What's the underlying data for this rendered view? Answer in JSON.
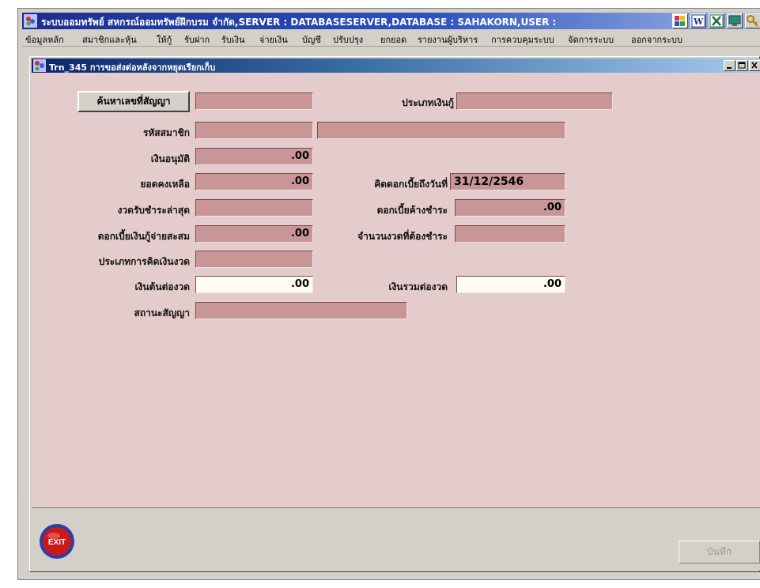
{
  "app": {
    "title": "ระบบออมทรัพย์ สหกรณ์ออมทรัพย์ฝึกบรม จำกัด,SERVER : DATABASESERVER,DATABASE : SAHAKORN,USER :"
  },
  "menu": [
    "ข้อมูลหลัก",
    "สมาชิกและหุ้น",
    "ให้กู้",
    "รับฝาก",
    "รับเงิน",
    "จ่ายเงิน",
    "บัญชี",
    "ปรับปรุง",
    "ยกยอด",
    "รายงานผู้บริหาร",
    "การควบคุมระบบ",
    "จัดการระบบ",
    "ออกจากระบบ"
  ],
  "window": {
    "title": "Trn_345 การขอส่งต่อหลังจากหยุดเรียกเก็บ"
  },
  "form": {
    "search_button": "ค้นหาเลขที่สัญญา",
    "labels": {
      "loan_type": "ประเภทเงินกู้",
      "member_code": "รหัสสมาชิก",
      "approved_amount": "เงินอนุมัติ",
      "balance": "ยอดคงเหลือ",
      "interest_to_date": "คิดดอกเบี้ยถึงวันที่",
      "last_installment": "งวดรับชำระล่าสุด",
      "interest_due": "ดอกเบี้ยค้างชำระ",
      "accumulated_interest": "ดอกเบี้ยเงินกู้จ่ายสะสม",
      "installments_due": "จำนวนงวดที่ต้องชำระ",
      "installment_calc_type": "ประเภทการคิดเงินงวด",
      "principal_per_installment": "เงินต้นต่องวด",
      "total_per_installment": "เงินรวมต่องวด",
      "contract_status": "สถานะสัญญา"
    },
    "values": {
      "contract_no": "",
      "loan_type": "",
      "member_code": "",
      "member_name": "",
      "approved_amount": ".00",
      "balance": ".00",
      "interest_to_date": "31/12/2546",
      "last_installment": "",
      "interest_due": ".00",
      "accumulated_interest": ".00",
      "installments_due": "",
      "installment_calc_type": "",
      "principal_per_installment": ".00",
      "total_per_installment": ".00",
      "contract_status": ""
    }
  },
  "footer": {
    "exit_label": "EXIT",
    "save_label": "บันทึก"
  },
  "colors": {
    "form_background": "#e5cccc",
    "field_background": "#c89696",
    "editable_field_background": "#fffbef"
  }
}
